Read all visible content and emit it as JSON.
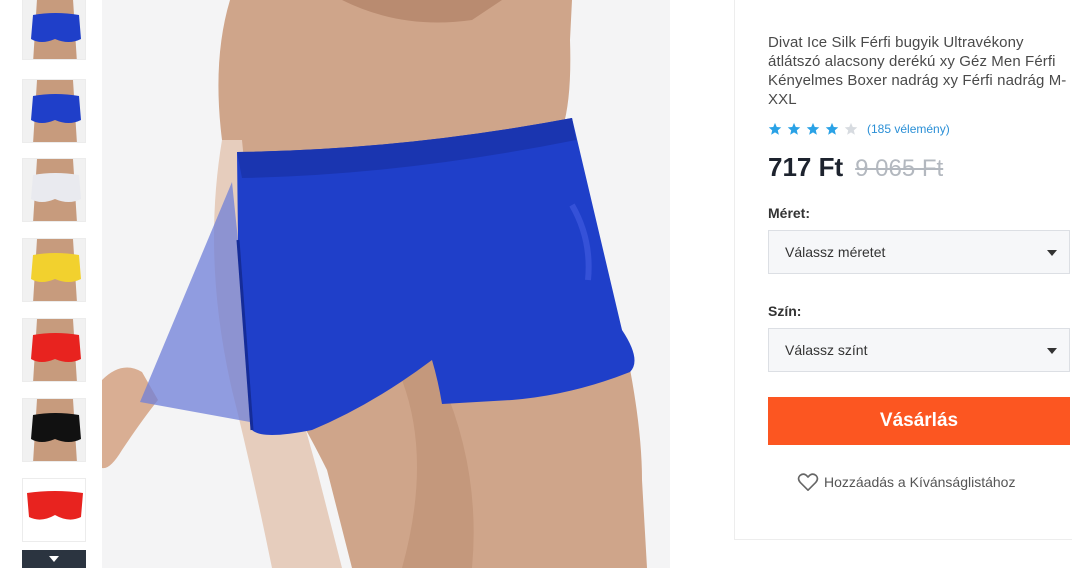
{
  "thumbnails": [
    {
      "name": "thumb-blue-side",
      "body": "#c79b7d",
      "garment": "#1f3fc9"
    },
    {
      "name": "thumb-blue-back",
      "body": "#c79b7d",
      "garment": "#1f3fc9"
    },
    {
      "name": "thumb-white",
      "body": "#c79b7d",
      "garment": "#e9eaef"
    },
    {
      "name": "thumb-yellow",
      "body": "#c79b7d",
      "garment": "#f2d12e"
    },
    {
      "name": "thumb-red",
      "body": "#c79b7d",
      "garment": "#e8231f"
    },
    {
      "name": "thumb-black",
      "body": "#c79b7d",
      "garment": "#111111"
    },
    {
      "name": "thumb-red-flat",
      "body": "#ffffff",
      "garment": "#e8231f"
    }
  ],
  "thumb_scroll_icon": "chevron-down-icon",
  "product": {
    "title": "Divat Ice Silk Férfi bugyik Ultravékony átlátszó alacsony derékú xy Géz Men Férfi Kényelmes Boxer nadrág xy Férfi nadrág M-XXL",
    "rating": 4,
    "rating_max": 5,
    "reviews": "(185 vélemény)",
    "price": "717 Ft",
    "old_price": "9 065 Ft"
  },
  "size": {
    "label": "Méret:",
    "placeholder": "Válassz méretet"
  },
  "color": {
    "label": "Szín:",
    "placeholder": "Válassz színt"
  },
  "buy_label": "Vásárlás",
  "wishlist_label": "Hozzáadás a Kívánságlistához",
  "colors": {
    "accent": "#fc5621",
    "star": "#2aa2e6",
    "star_empty": "#d7dbe0",
    "link": "#2a8fd6",
    "product_blue": "#1f3fc9"
  }
}
